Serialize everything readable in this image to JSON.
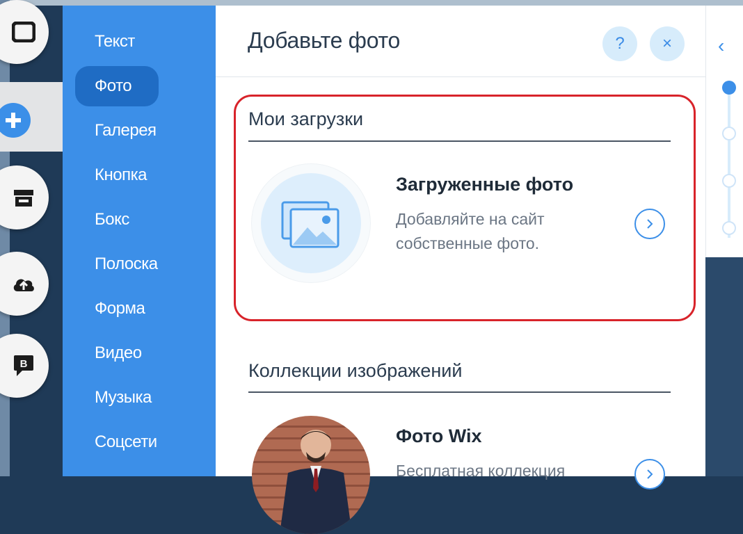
{
  "sidebar": {
    "items": [
      {
        "label": "Текст"
      },
      {
        "label": "Фото"
      },
      {
        "label": "Галерея"
      },
      {
        "label": "Кнопка"
      },
      {
        "label": "Бокс"
      },
      {
        "label": "Полоска"
      },
      {
        "label": "Форма"
      },
      {
        "label": "Видео"
      },
      {
        "label": "Музыка"
      },
      {
        "label": "Соцсети"
      }
    ],
    "active_index": 1
  },
  "rail": {
    "icons": [
      "page-icon",
      "add-icon",
      "store-icon",
      "upload-icon",
      "blog-icon"
    ]
  },
  "panel": {
    "title": "Добавьте фото",
    "help_label": "?",
    "close_label": "×"
  },
  "uploads": {
    "section_title": "Мои загрузки",
    "card_title": "Загруженные фото",
    "card_desc": "Добавляйте на сайт собственные фото."
  },
  "collections": {
    "section_title": "Коллекции изображений",
    "card_title": "Фото Wix",
    "card_desc": "Бесплатная коллекция"
  },
  "colors": {
    "sidebar": "#3c8fe8",
    "sidebar_active": "#1f6cc4",
    "highlight": "#d8232a",
    "accent": "#3c8fe8"
  }
}
